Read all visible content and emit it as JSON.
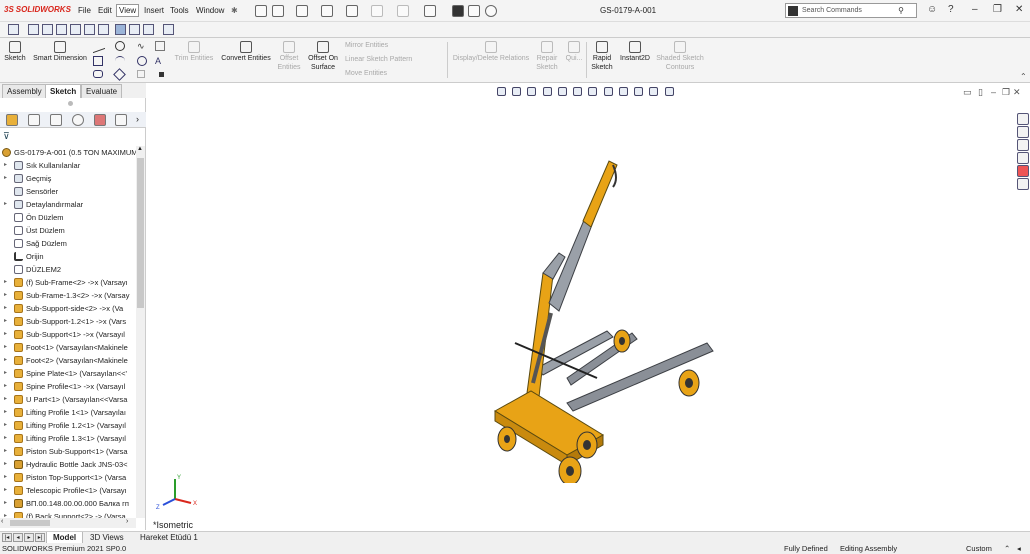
{
  "app": {
    "logo_prefix": "3S",
    "logo_text": "SOLIDWORKS",
    "menu": [
      "File",
      "Edit",
      "View",
      "Insert",
      "Tools",
      "Window"
    ],
    "active_menu": "View",
    "document_title": "GS-0179-A-001",
    "search_placeholder": "Search Commands"
  },
  "command_manager": {
    "buttons": [
      {
        "label": "Sketch",
        "enabled": true
      },
      {
        "label": "Smart Dimension",
        "enabled": true
      },
      {
        "label": "Trim Entities",
        "enabled": false
      },
      {
        "label": "Convert Entities",
        "enabled": true
      },
      {
        "label": "Offset Entities",
        "enabled": false
      },
      {
        "label": "Offset On Surface",
        "enabled": true
      },
      {
        "label": "Display/Delete Relations",
        "enabled": false
      },
      {
        "label": "Repair Sketch",
        "enabled": false
      },
      {
        "label": "Qui...",
        "enabled": false
      },
      {
        "label": "Rapid Sketch",
        "enabled": true
      },
      {
        "label": "Instant2D",
        "enabled": true
      },
      {
        "label": "Shaded Sketch Contours",
        "enabled": false
      }
    ],
    "small_items": [
      "Mirror Entities",
      "Linear Sketch Pattern",
      "Move Entities"
    ]
  },
  "tabs": {
    "items": [
      "Assembly",
      "Sketch",
      "Evaluate"
    ],
    "active": "Sketch"
  },
  "tree": {
    "root": "GS-0179-A-001  (0.5 TON MAXIMUM",
    "items": [
      {
        "label": "Sık Kullanılanlar",
        "icon": "folder",
        "arrow": true
      },
      {
        "label": "Geçmiş",
        "icon": "folder",
        "arrow": true
      },
      {
        "label": "Sensörler",
        "icon": "folder",
        "arrow": false
      },
      {
        "label": "Detaylandırmalar",
        "icon": "folder",
        "arrow": true
      },
      {
        "label": "Ön Düzlem",
        "icon": "plane",
        "arrow": false
      },
      {
        "label": "Üst Düzlem",
        "icon": "plane",
        "arrow": false
      },
      {
        "label": "Sağ Düzlem",
        "icon": "plane",
        "arrow": false
      },
      {
        "label": "Orijin",
        "icon": "origin",
        "arrow": false
      },
      {
        "label": "DÜZLEM2",
        "icon": "plane",
        "arrow": false
      },
      {
        "label": "(f) Sub-Frame<2> ->x (Varsayı",
        "icon": "part",
        "arrow": true
      },
      {
        "label": "Sub-Frame-1.3<2> ->x (Varsay",
        "icon": "part",
        "arrow": true
      },
      {
        "label": "Sub-Support-side<2> ->x (Va",
        "icon": "part",
        "arrow": true
      },
      {
        "label": "Sub-Support-1.2<1> ->x (Vars",
        "icon": "part",
        "arrow": true
      },
      {
        "label": "Sub-Support<1> ->x (Varsayıl",
        "icon": "part",
        "arrow": true
      },
      {
        "label": "Foot<1> (Varsayılan<Makinele",
        "icon": "part",
        "arrow": true
      },
      {
        "label": "Foot<2> (Varsayılan<Makinele",
        "icon": "part",
        "arrow": true
      },
      {
        "label": "Spine Plate<1> (Varsayılan<<'",
        "icon": "part",
        "arrow": true
      },
      {
        "label": "Spine Profile<1> ->x (Varsayıl",
        "icon": "part",
        "arrow": true
      },
      {
        "label": "U Part<1> (Varsayılan<<Varsa",
        "icon": "part",
        "arrow": true
      },
      {
        "label": "Lifting Profile 1<1> (Varsayılaı",
        "icon": "part",
        "arrow": true
      },
      {
        "label": "Lifting Profile 1.2<1> (Varsayıl",
        "icon": "part",
        "arrow": true
      },
      {
        "label": "Lifting Profile 1.3<1> (Varsayıl",
        "icon": "part",
        "arrow": true
      },
      {
        "label": "Piston Sub-Support<1> (Varsa",
        "icon": "part",
        "arrow": true
      },
      {
        "label": "Hydraulic Bottle Jack JNS-03<",
        "icon": "asm",
        "arrow": true
      },
      {
        "label": "Piston Top-Support<1> (Varsa",
        "icon": "part",
        "arrow": true
      },
      {
        "label": "Telescopic Profile<1> (Varsayı",
        "icon": "part",
        "arrow": true
      },
      {
        "label": "ВП.00.148.00.00.000 Балка гп",
        "icon": "asm",
        "arrow": true
      },
      {
        "label": "(f) Back Support<2> -> (Varsa",
        "icon": "part",
        "arrow": true
      }
    ]
  },
  "viewport": {
    "view_label": "*Isometric",
    "triad": {
      "x": "X",
      "y": "Y",
      "z": "Z"
    }
  },
  "bottom_tabs": {
    "items": [
      "Model",
      "3D Views",
      "Hareket Etüdü 1"
    ],
    "active": "Model"
  },
  "status": {
    "left": "SOLIDWORKS Premium 2021 SP0.0",
    "fully_defined": "Fully Defined",
    "mode": "Editing Assembly",
    "units": "Custom"
  },
  "colors": {
    "model_yellow": "#e8a316",
    "model_dark": "#5a4a10",
    "model_gray": "#8a8f97",
    "accent_red": "#d9261c"
  }
}
